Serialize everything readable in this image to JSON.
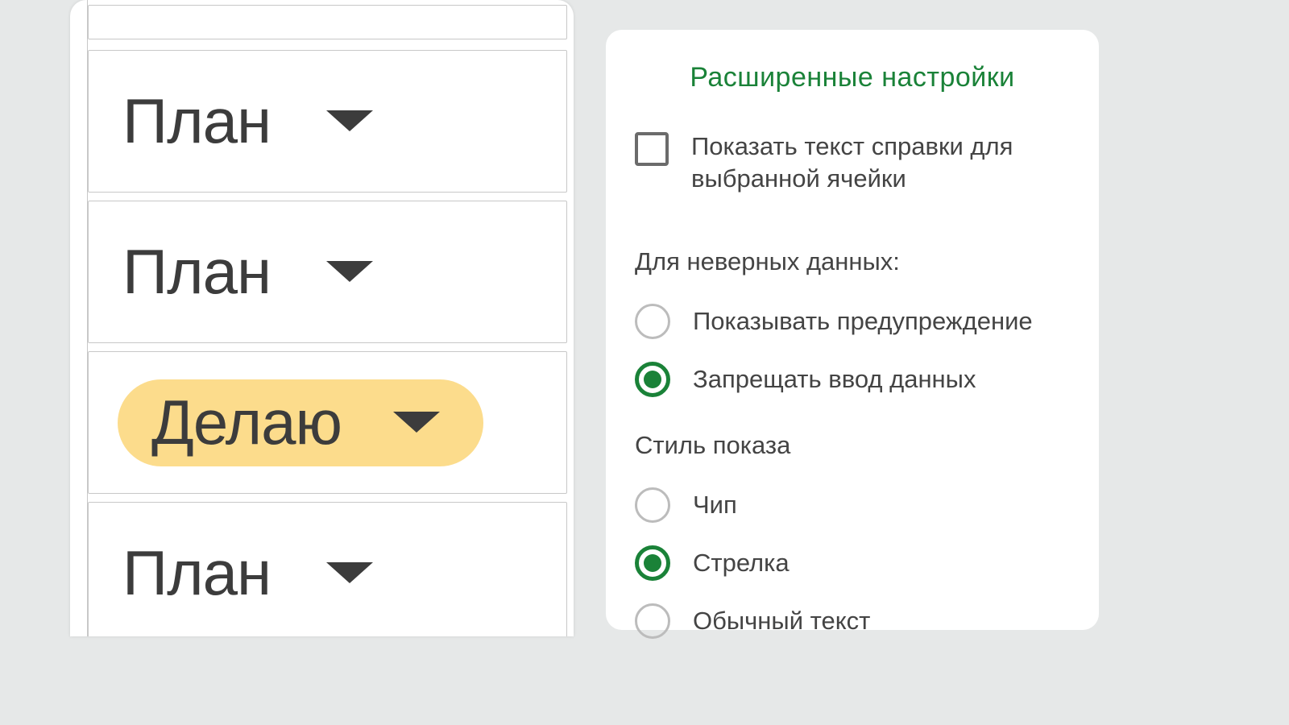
{
  "spreadsheet": {
    "cells": [
      {
        "label": "План",
        "chip": false
      },
      {
        "label": "План",
        "chip": false
      },
      {
        "label": "Делаю",
        "chip": true
      },
      {
        "label": "План",
        "chip": false
      }
    ]
  },
  "panel": {
    "title": "Расширенные настройки",
    "help_checkbox_label": "Показать текст справки для выбранной ячейки",
    "invalid_data_label": "Для неверных данных:",
    "invalid_options": {
      "warn": "Показывать предупреждение",
      "reject": "Запрещать ввод данных"
    },
    "display_style_label": "Стиль показа",
    "display_options": {
      "chip": "Чип",
      "arrow": "Стрелка",
      "plain": "Обычный текст"
    }
  },
  "colors": {
    "accent_green": "#1a8238",
    "chip_yellow": "#fcdc8c"
  }
}
